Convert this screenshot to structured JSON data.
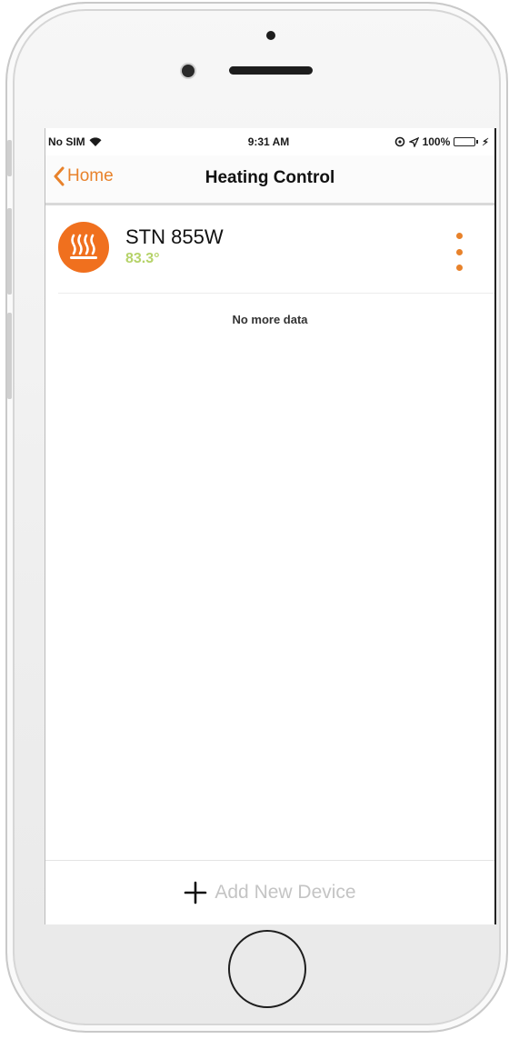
{
  "status_bar": {
    "carrier": "No SIM",
    "time": "9:31 AM",
    "battery_percent": "100%",
    "battery_level": 1.0,
    "icons": [
      "wifi-icon",
      "alarm-icon",
      "location-icon",
      "battery-icon",
      "charging-icon"
    ]
  },
  "nav": {
    "back_label": "Home",
    "title": "Heating Control"
  },
  "device": {
    "name": "STN 855W",
    "temperature": "83.3°",
    "icon": "heating-icon",
    "menu_icon": "more-vertical-icon"
  },
  "list": {
    "end_message": "No more data"
  },
  "footer": {
    "add_label": "Add New Device",
    "icon": "plus-icon"
  },
  "colors": {
    "accent": "#e8822b",
    "device_icon_bg": "#f0701e",
    "temperature": "#b6d36a",
    "battery": "#3ad24a"
  }
}
